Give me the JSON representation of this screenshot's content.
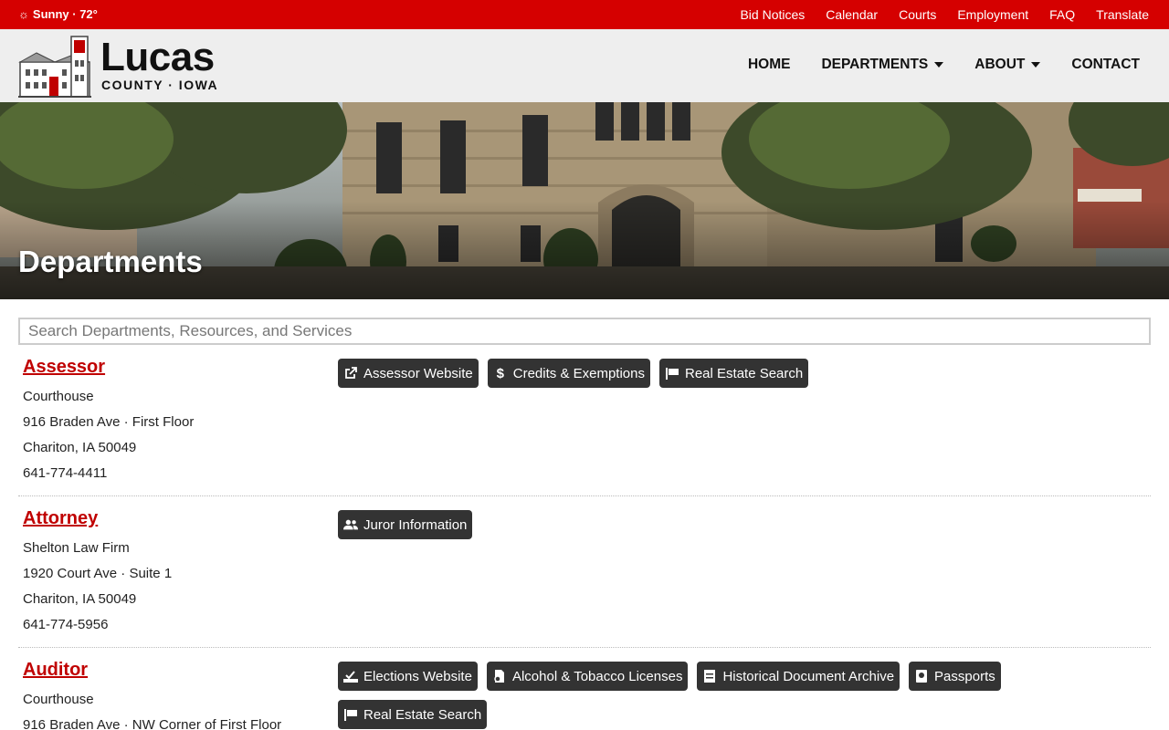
{
  "topbar": {
    "weather": "Sunny · 72°",
    "links": [
      "Bid Notices",
      "Calendar",
      "Courts",
      "Employment",
      "FAQ",
      "Translate"
    ]
  },
  "logo": {
    "name": "Lucas",
    "subtitle": "COUNTY · IOWA"
  },
  "nav": {
    "home": "HOME",
    "departments": "DEPARTMENTS",
    "about": "ABOUT",
    "contact": "CONTACT"
  },
  "hero": {
    "title": "Departments"
  },
  "search": {
    "placeholder": "Search Departments, Resources, and Services"
  },
  "departments": [
    {
      "name": "Assessor",
      "lines": [
        "Courthouse",
        "916 Braden Ave · First Floor",
        "Chariton, IA 50049",
        "641-774-4411"
      ],
      "buttons": [
        {
          "label": "Assessor Website",
          "icon": "external-link-icon"
        },
        {
          "label": "Credits & Exemptions",
          "icon": "dollar-icon"
        },
        {
          "label": "Real Estate Search",
          "icon": "sign-icon"
        }
      ]
    },
    {
      "name": "Attorney",
      "lines": [
        "Shelton Law Firm",
        "1920 Court Ave · Suite 1",
        "Chariton, IA 50049",
        "641-774-5956"
      ],
      "buttons": [
        {
          "label": "Juror Information",
          "icon": "people-icon"
        }
      ]
    },
    {
      "name": "Auditor",
      "lines": [
        "Courthouse",
        "916 Braden Ave · NW Corner of First Floor"
      ],
      "buttons": [
        {
          "label": "Elections Website",
          "icon": "ballot-icon"
        },
        {
          "label": "Alcohol & Tobacco Licenses",
          "icon": "license-icon"
        },
        {
          "label": "Historical Document Archive",
          "icon": "archive-icon"
        },
        {
          "label": "Passports",
          "icon": "passport-icon"
        },
        {
          "label": "Real Estate Search",
          "icon": "sign-icon"
        }
      ]
    }
  ],
  "colors": {
    "accent": "#d50000",
    "header_bg": "#eeeeee",
    "button_bg": "#333333",
    "dept_name": "#c00000"
  }
}
